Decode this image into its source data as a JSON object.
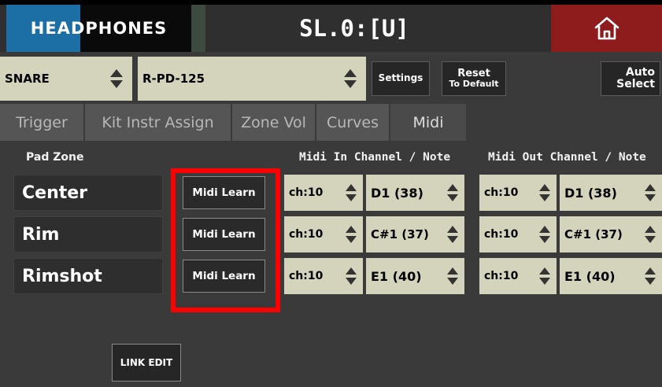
{
  "topbar": {
    "headphones_label": "HEADPHONES",
    "kit_title": "SL.0:[U]",
    "home_icon": "home-icon",
    "colors": {
      "headphones_accent": "#1c6fa5",
      "home_bg": "#8e1c1c"
    }
  },
  "selectors": {
    "pad": "SNARE",
    "pad_model": "R-PD-125",
    "settings_label": "Settings",
    "reset_line1": "Reset",
    "reset_line2": "To Default",
    "auto_line1": "Auto",
    "auto_line2": "Select"
  },
  "tabs": [
    {
      "label": "Trigger",
      "active": false
    },
    {
      "label": "Kit Instr Assign",
      "active": false
    },
    {
      "label": "Zone Vol",
      "active": false
    },
    {
      "label": "Curves",
      "active": false
    },
    {
      "label": "Midi",
      "active": true
    }
  ],
  "headers": {
    "pad_zone": "Pad Zone",
    "midi_in": "Midi In Channel / Note",
    "midi_out": "Midi Out Channel / Note"
  },
  "rows": [
    {
      "zone": "Center",
      "learn": "Midi Learn",
      "in_ch": "ch:10",
      "in_note": "D1 (38)",
      "out_ch": "ch:10",
      "out_note": "D1 (38)"
    },
    {
      "zone": "Rim",
      "learn": "Midi Learn",
      "in_ch": "ch:10",
      "in_note": "C#1 (37)",
      "out_ch": "ch:10",
      "out_note": "C#1 (37)"
    },
    {
      "zone": "Rimshot",
      "learn": "Midi Learn",
      "in_ch": "ch:10",
      "in_note": "E1 (40)",
      "out_ch": "ch:10",
      "out_note": "E1 (40)"
    }
  ],
  "link_edit_label": "LINK EDIT",
  "highlight_color": "#ff0000"
}
